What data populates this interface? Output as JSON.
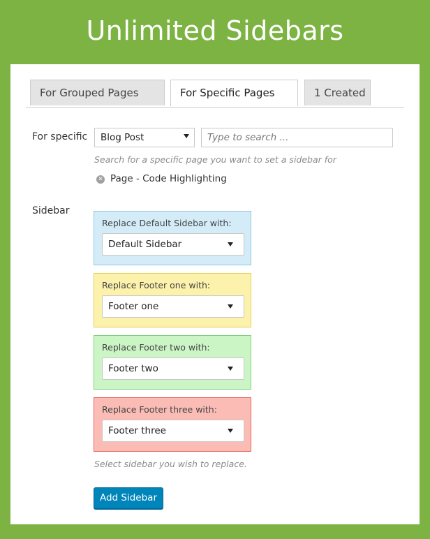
{
  "banner": {
    "title": "Unlimited Sidebars"
  },
  "tabs": [
    {
      "label": "For Grouped Pages"
    },
    {
      "label": "For Specific Pages"
    },
    {
      "label": "1 Created"
    }
  ],
  "specific": {
    "label": "For specific",
    "type_select": {
      "value": "Blog Post"
    },
    "search": {
      "placeholder": "Type to search ..."
    },
    "hint": "Search for a specific page you want to set a sidebar for",
    "selected_tag": "Page - Code Highlighting"
  },
  "sidebar": {
    "label": "Sidebar",
    "replacements": [
      {
        "label": "Replace Default Sidebar with:",
        "value": "Default Sidebar",
        "bg": "#d3ecf7",
        "border": "#8ec9e4"
      },
      {
        "label": "Replace Footer one with:",
        "value": "Footer one",
        "bg": "#fdf2ab",
        "border": "#e3cf5e"
      },
      {
        "label": "Replace Footer two with:",
        "value": "Footer two",
        "bg": "#ccf5c6",
        "border": "#7fd07a"
      },
      {
        "label": "Replace Footer three with:",
        "value": "Footer three",
        "bg": "#fbbcb6",
        "border": "#e5645a"
      }
    ],
    "hint": "Select sidebar you wish to replace.",
    "add_button": "Add Sidebar"
  },
  "colors": {
    "background": "#7cb342",
    "button": "#0085ba"
  }
}
